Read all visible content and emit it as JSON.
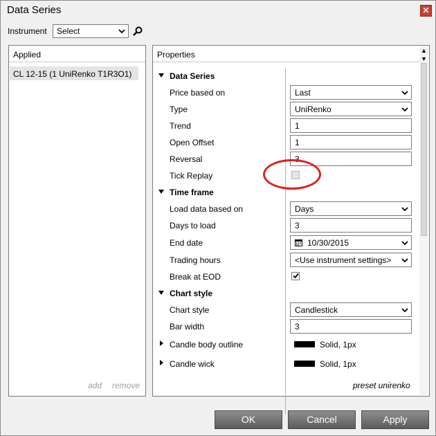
{
  "window": {
    "title": "Data Series",
    "close_glyph": "✕"
  },
  "instrument": {
    "label": "Instrument",
    "select_value": "Select"
  },
  "applied": {
    "header": "Applied",
    "items": [
      "CL 12-15 (1 UniRenko T1R3O1)"
    ],
    "add_label": "add",
    "remove_label": "remove"
  },
  "properties": {
    "header": "Properties",
    "preset_label": "preset unirenko",
    "data_series": {
      "title": "Data Series",
      "price_based_on": {
        "label": "Price based on",
        "value": "Last"
      },
      "type": {
        "label": "Type",
        "value": "UniRenko"
      },
      "trend": {
        "label": "Trend",
        "value": "1"
      },
      "open_offset": {
        "label": "Open Offset",
        "value": "1"
      },
      "reversal": {
        "label": "Reversal",
        "value": "3"
      },
      "tick_replay": {
        "label": "Tick Replay",
        "checked": false
      }
    },
    "time_frame": {
      "title": "Time frame",
      "load_data_based_on": {
        "label": "Load data based on",
        "value": "Days"
      },
      "days_to_load": {
        "label": "Days to load",
        "value": "3"
      },
      "end_date": {
        "label": "End date",
        "value": "10/30/2015"
      },
      "trading_hours": {
        "label": "Trading hours",
        "value": "<Use instrument settings>"
      },
      "break_at_eod": {
        "label": "Break at EOD",
        "checked": true
      }
    },
    "chart_style": {
      "title": "Chart style",
      "chart_style": {
        "label": "Chart style",
        "value": "Candlestick"
      },
      "bar_width": {
        "label": "Bar width",
        "value": "3"
      },
      "candle_body_outline": {
        "label": "Candle body outline",
        "value": "Solid, 1px"
      },
      "candle_wick": {
        "label": "Candle wick",
        "value": "Solid, 1px"
      }
    }
  },
  "buttons": {
    "ok": "OK",
    "cancel": "Cancel",
    "apply": "Apply"
  },
  "colors": {
    "highlight_circle": "#e02020",
    "close_button": "#c9402f"
  }
}
